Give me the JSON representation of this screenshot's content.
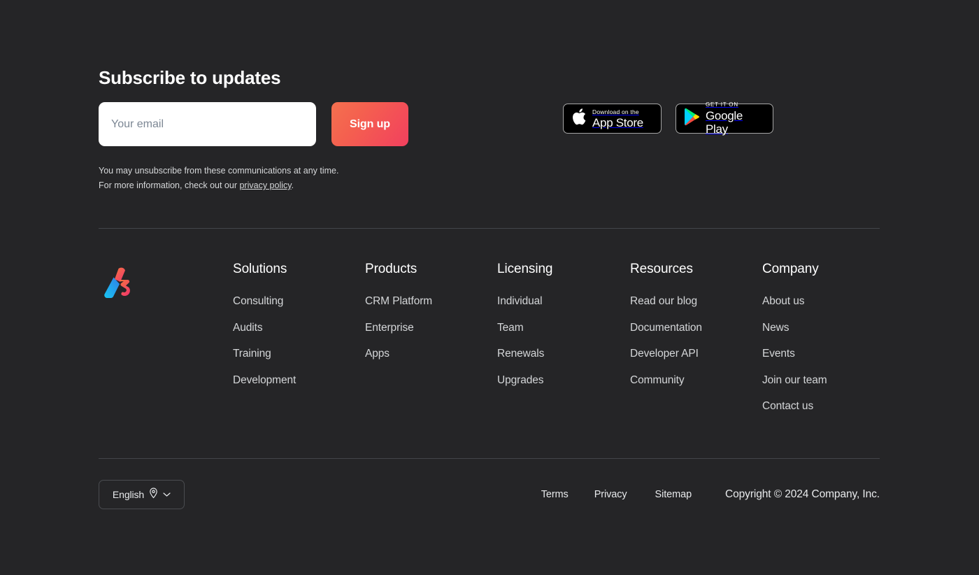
{
  "subscribe": {
    "title": "Subscribe to updates",
    "email_placeholder": "Your email",
    "email_value": "",
    "signup_label": "Sign up",
    "fineprint_line1": "You may unsubscribe from these communications at any time.",
    "fineprint_line2_prefix": "For more information, check out our ",
    "fineprint_link": "privacy policy",
    "fineprint_line2_suffix": "."
  },
  "badges": {
    "apple": {
      "small": "Download on the",
      "big": "App Store",
      "icon": "apple-icon"
    },
    "google": {
      "small": "GET IT ON",
      "big": "Google Play",
      "icon": "google-play-icon"
    }
  },
  "brand": {
    "logo_name": "company-logo"
  },
  "columns": [
    {
      "heading": "Solutions",
      "links": [
        "Consulting",
        "Audits",
        "Training",
        "Development"
      ]
    },
    {
      "heading": "Products",
      "links": [
        "CRM Platform",
        "Enterprise",
        "Apps"
      ]
    },
    {
      "heading": "Licensing",
      "links": [
        "Individual",
        "Team",
        "Renewals",
        "Upgrades"
      ]
    },
    {
      "heading": "Resources",
      "links": [
        "Read our blog",
        "Documentation",
        "Developer API",
        "Community"
      ]
    },
    {
      "heading": "Company",
      "links": [
        "About us",
        "News",
        "Events",
        "Join our team",
        "Contact us"
      ]
    }
  ],
  "bottom": {
    "language": "English",
    "language_pin_icon": "location-pin-icon",
    "language_chevron_icon": "chevron-down-icon",
    "terms": "Terms",
    "privacy": "Privacy",
    "sitemap": "Sitemap",
    "copyright": "Copyright © 2024 Company, Inc."
  },
  "colors": {
    "background": "#252527",
    "divider": "#43454a",
    "accent_orange": "#f4704f",
    "accent_pink": "#f2405e",
    "link_text": "#d4d6d8",
    "heading_text": "#ffffff",
    "logo_blue": "#2aa7e8",
    "logo_orange": "#f4704f",
    "logo_pink": "#f2405e"
  }
}
